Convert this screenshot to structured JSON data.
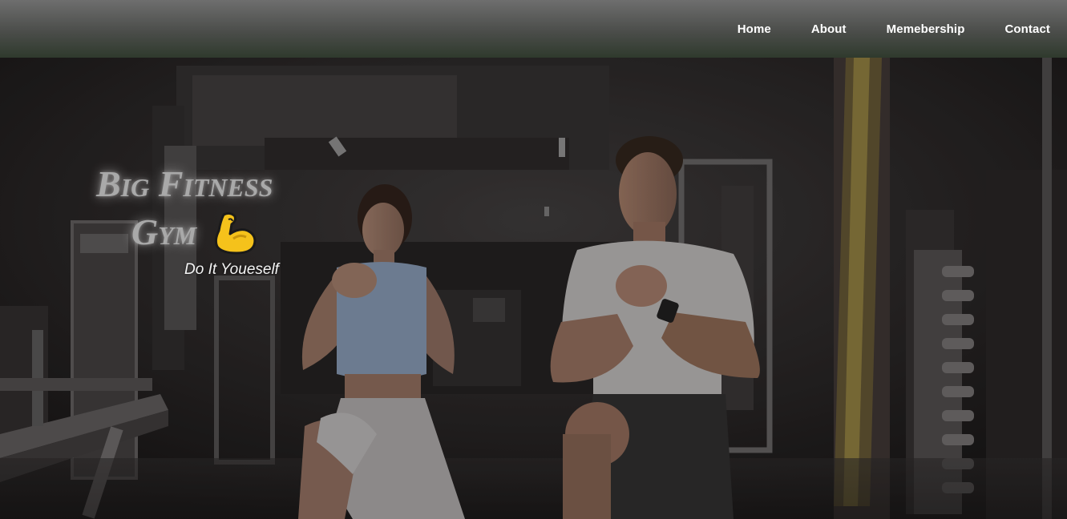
{
  "nav": {
    "items": [
      {
        "label": "Home"
      },
      {
        "label": "About"
      },
      {
        "label": "Memebership"
      },
      {
        "label": "Contact"
      }
    ]
  },
  "hero": {
    "title_line_1": "Big Fitness",
    "title_line_2": "Gym",
    "tagline": "Do It Youeself",
    "icon": "flexed-biceps-icon",
    "background": "gym-two-people-lunging-photo"
  },
  "colors": {
    "nav_gradient_top": "#6e6e6e",
    "nav_gradient_bottom": "#2f3a2d",
    "title": "#a9a9a9",
    "tagline": "#f4f4f4",
    "biceps": "#f5c21b"
  }
}
